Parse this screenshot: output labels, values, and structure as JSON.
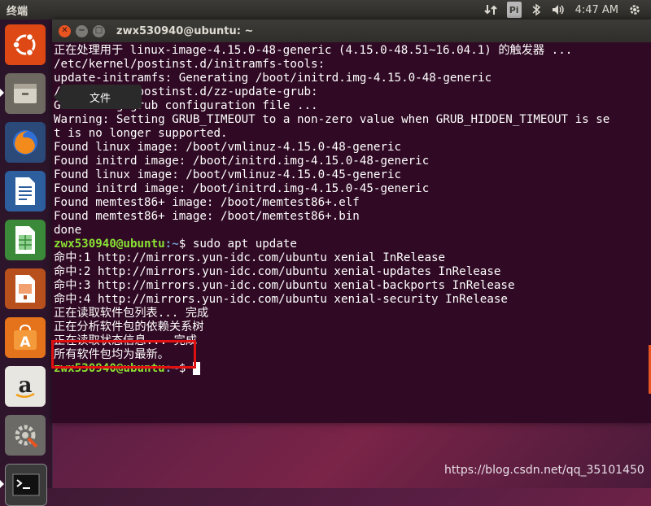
{
  "top_panel": {
    "app_name": "终端",
    "input_method": "Pi",
    "time": "4:47 AM"
  },
  "launcher": {
    "tooltip": "文件",
    "items": [
      {
        "name": "ubuntu-dash-icon"
      },
      {
        "name": "files-icon"
      },
      {
        "name": "firefox-icon"
      },
      {
        "name": "libreoffice-writer-icon"
      },
      {
        "name": "libreoffice-calc-icon"
      },
      {
        "name": "libreoffice-impress-icon"
      },
      {
        "name": "ubuntu-software-icon"
      },
      {
        "name": "amazon-icon"
      },
      {
        "name": "system-settings-icon"
      },
      {
        "name": "terminal-icon"
      }
    ]
  },
  "terminal": {
    "title": "zwx530940@ubuntu: ~",
    "prompt_user": "zwx530940@ubuntu",
    "prompt_path": ":~",
    "lines": [
      "正在处理用于 linux-image-4.15.0-48-generic (4.15.0-48.51~16.04.1) 的触发器 ...",
      "/etc/kernel/postinst.d/initramfs-tools:",
      "update-initramfs: Generating /boot/initrd.img-4.15.0-48-generic",
      "/etc/kernel/postinst.d/zz-update-grub:",
      "Generating grub configuration file ...",
      "Warning: Setting GRUB_TIMEOUT to a non-zero value when GRUB_HIDDEN_TIMEOUT is se",
      "t is no longer supported.",
      "Found linux image: /boot/vmlinuz-4.15.0-48-generic",
      "Found initrd image: /boot/initrd.img-4.15.0-48-generic",
      "Found linux image: /boot/vmlinuz-4.15.0-45-generic",
      "Found initrd image: /boot/initrd.img-4.15.0-45-generic",
      "Found memtest86+ image: /boot/memtest86+.elf",
      "Found memtest86+ image: /boot/memtest86+.bin",
      "done"
    ],
    "command": "$ sudo apt update",
    "output": [
      "命中:1 http://mirrors.yun-idc.com/ubuntu xenial InRelease",
      "命中:2 http://mirrors.yun-idc.com/ubuntu xenial-updates InRelease",
      "命中:3 http://mirrors.yun-idc.com/ubuntu xenial-backports InRelease",
      "命中:4 http://mirrors.yun-idc.com/ubuntu xenial-security InRelease",
      "正在读取软件包列表... 完成",
      "正在分析软件包的依赖关系树",
      "正在读取状态信息... 完成",
      "所有软件包均为最新。"
    ],
    "final_prompt_suffix": "$ "
  },
  "watermark": "https://blog.csdn.net/qq_35101450",
  "colors": {
    "accent": "#e95420",
    "terminal_bg": "#300a24",
    "prompt_user": "#8ae234",
    "prompt_path": "#729fcf",
    "highlight": "#e01010"
  }
}
